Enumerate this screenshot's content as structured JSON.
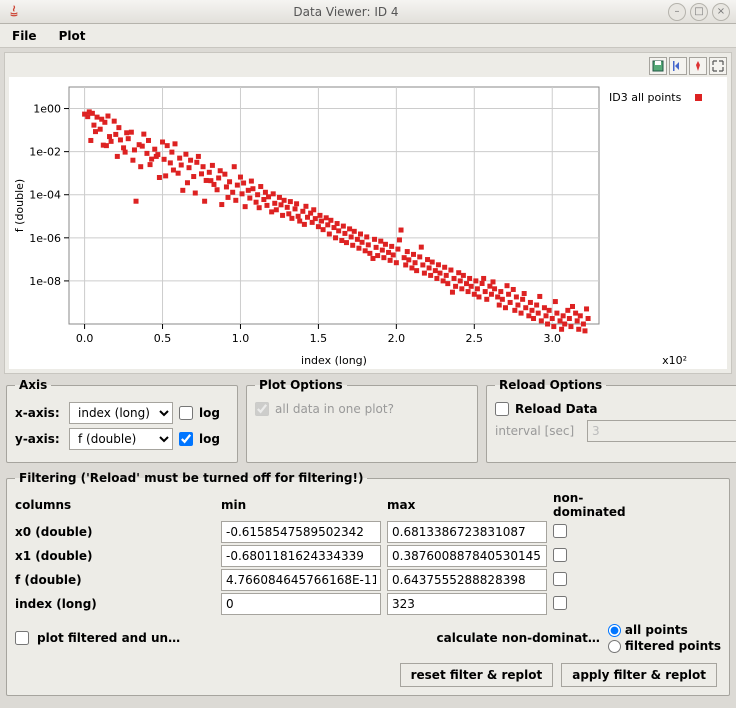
{
  "window": {
    "title": "Data Viewer: ID 4"
  },
  "menubar": {
    "file": "File",
    "plot": "Plot"
  },
  "chart_data": {
    "type": "scatter",
    "xlabel": "index (long)",
    "ylabel": "f (double)",
    "x_ticks": [
      0.0,
      0.5,
      1.0,
      1.5,
      2.0,
      2.5,
      3.0
    ],
    "x_scale_label": "x10²",
    "y_ticks_log10": [
      -8,
      -6,
      -4,
      -2,
      0
    ],
    "y_tick_labels": [
      "1e-08",
      "1e-06",
      "1e-04",
      "1e-02",
      "1e00"
    ],
    "xlim": [
      -0.1,
      3.3
    ],
    "ylim_log10": [
      -10,
      1
    ],
    "legend": [
      {
        "name": "ID3 all points",
        "color": "#dd2222"
      }
    ],
    "series": [
      {
        "name": "ID3 all points",
        "color": "#dd2222",
        "points": [
          [
            0.0,
            0.55
          ],
          [
            0.02,
            0.42
          ],
          [
            0.03,
            0.7
          ],
          [
            0.04,
            0.033
          ],
          [
            0.05,
            0.6
          ],
          [
            0.06,
            0.17
          ],
          [
            0.07,
            0.085
          ],
          [
            0.08,
            0.4
          ],
          [
            0.1,
            0.11
          ],
          [
            0.11,
            0.32
          ],
          [
            0.12,
            0.02
          ],
          [
            0.13,
            0.23
          ],
          [
            0.14,
            0.019
          ],
          [
            0.15,
            0.45
          ],
          [
            0.16,
            0.05
          ],
          [
            0.17,
            0.03
          ],
          [
            0.19,
            0.26
          ],
          [
            0.2,
            0.063
          ],
          [
            0.21,
            0.006
          ],
          [
            0.22,
            0.13
          ],
          [
            0.23,
            0.035
          ],
          [
            0.25,
            0.015
          ],
          [
            0.26,
            0.0095
          ],
          [
            0.27,
            0.075
          ],
          [
            0.28,
            0.04
          ],
          [
            0.3,
            0.08
          ],
          [
            0.31,
            0.004
          ],
          [
            0.32,
            0.012
          ],
          [
            0.33,
            5e-05
          ],
          [
            0.35,
            0.021
          ],
          [
            0.36,
            0.002
          ],
          [
            0.37,
            0.018
          ],
          [
            0.38,
            0.065
          ],
          [
            0.4,
            0.0083
          ],
          [
            0.41,
            0.033
          ],
          [
            0.42,
            0.0025
          ],
          [
            0.43,
            0.0045
          ],
          [
            0.45,
            0.013
          ],
          [
            0.46,
            0.006
          ],
          [
            0.47,
            0.0073
          ],
          [
            0.48,
            0.00063
          ],
          [
            0.5,
            0.028
          ],
          [
            0.51,
            0.0044
          ],
          [
            0.52,
            0.00075
          ],
          [
            0.53,
            0.019
          ],
          [
            0.55,
            0.003
          ],
          [
            0.56,
            0.0095
          ],
          [
            0.57,
            0.0014
          ],
          [
            0.58,
            0.023
          ],
          [
            0.6,
            0.001
          ],
          [
            0.61,
            0.005
          ],
          [
            0.62,
            0.0024
          ],
          [
            0.63,
            0.00016
          ],
          [
            0.65,
            0.0076
          ],
          [
            0.66,
            0.00036
          ],
          [
            0.67,
            0.0018
          ],
          [
            0.68,
            0.004
          ],
          [
            0.7,
            0.0007
          ],
          [
            0.71,
            0.00012
          ],
          [
            0.72,
            0.0032
          ],
          [
            0.73,
            0.006
          ],
          [
            0.75,
            0.00093
          ],
          [
            0.76,
            0.002
          ],
          [
            0.77,
            5e-05
          ],
          [
            0.78,
            0.00046
          ],
          [
            0.8,
            0.0011
          ],
          [
            0.81,
            0.00045
          ],
          [
            0.82,
            0.0023
          ],
          [
            0.83,
            0.0003
          ],
          [
            0.85,
            0.00017
          ],
          [
            0.86,
            0.0006
          ],
          [
            0.87,
            0.0013
          ],
          [
            0.88,
            3.5e-05
          ],
          [
            0.9,
            0.0009
          ],
          [
            0.91,
            0.00023
          ],
          [
            0.92,
            7.5e-05
          ],
          [
            0.93,
            0.0004
          ],
          [
            0.95,
            0.00013
          ],
          [
            0.96,
            0.002
          ],
          [
            0.97,
            5.5e-05
          ],
          [
            0.98,
            0.00028
          ],
          [
            1.0,
            0.00066
          ],
          [
            1.01,
            0.00011
          ],
          [
            1.02,
            0.00035
          ],
          [
            1.03,
            2.8e-05
          ],
          [
            1.05,
            0.00016
          ],
          [
            1.06,
            7e-05
          ],
          [
            1.07,
            0.00043
          ],
          [
            1.08,
            0.00019
          ],
          [
            1.1,
            4.5e-05
          ],
          [
            1.11,
            0.0001
          ],
          [
            1.12,
            2.5e-05
          ],
          [
            1.13,
            0.00024
          ],
          [
            1.15,
            6e-05
          ],
          [
            1.16,
            0.00013
          ],
          [
            1.17,
            3.2e-05
          ],
          [
            1.18,
            8e-05
          ],
          [
            1.2,
            1.6e-05
          ],
          [
            1.21,
            0.00011
          ],
          [
            1.22,
            4e-05
          ],
          [
            1.23,
            2e-05
          ],
          [
            1.25,
            7.5e-05
          ],
          [
            1.26,
            3.4e-05
          ],
          [
            1.27,
            1.1e-05
          ],
          [
            1.28,
            5.5e-05
          ],
          [
            1.3,
            2.6e-05
          ],
          [
            1.31,
            1.3e-05
          ],
          [
            1.32,
            4.8e-05
          ],
          [
            1.33,
            8e-06
          ],
          [
            1.35,
            2.2e-05
          ],
          [
            1.36,
            3.8e-05
          ],
          [
            1.37,
            1e-05
          ],
          [
            1.38,
            6e-06
          ],
          [
            1.4,
            1.7e-05
          ],
          [
            1.41,
            4.2e-06
          ],
          [
            1.42,
            2.9e-05
          ],
          [
            1.43,
            9e-06
          ],
          [
            1.45,
            1.4e-05
          ],
          [
            1.46,
            5.2e-06
          ],
          [
            1.47,
            2e-05
          ],
          [
            1.48,
            7.8e-06
          ],
          [
            1.5,
            3.3e-06
          ],
          [
            1.51,
            1.1e-05
          ],
          [
            1.52,
            6e-06
          ],
          [
            1.53,
            2.4e-06
          ],
          [
            1.55,
            8.5e-06
          ],
          [
            1.56,
            4e-06
          ],
          [
            1.57,
            1.5e-06
          ],
          [
            1.58,
            6.5e-06
          ],
          [
            1.6,
            3e-06
          ],
          [
            1.61,
            1e-06
          ],
          [
            1.62,
            4.6e-06
          ],
          [
            1.63,
            2.1e-06
          ],
          [
            1.65,
            7.5e-07
          ],
          [
            1.66,
            3.5e-06
          ],
          [
            1.67,
            1.6e-06
          ],
          [
            1.68,
            6e-07
          ],
          [
            1.7,
            2.6e-06
          ],
          [
            1.71,
            1.1e-06
          ],
          [
            1.72,
            4.5e-07
          ],
          [
            1.73,
            2e-06
          ],
          [
            1.75,
            8.5e-07
          ],
          [
            1.76,
            3.3e-07
          ],
          [
            1.77,
            1.5e-06
          ],
          [
            1.78,
            6.2e-07
          ],
          [
            1.8,
            2.5e-07
          ],
          [
            1.81,
            1.1e-06
          ],
          [
            1.82,
            4.7e-07
          ],
          [
            1.83,
            1.9e-07
          ],
          [
            1.85,
            1.1e-07
          ],
          [
            1.86,
            8.5e-07
          ],
          [
            1.87,
            3.6e-07
          ],
          [
            1.88,
            1.5e-07
          ],
          [
            1.9,
            7e-07
          ],
          [
            1.91,
            2.7e-07
          ],
          [
            1.92,
            1.2e-07
          ],
          [
            1.93,
            5e-07
          ],
          [
            1.95,
            2.1e-07
          ],
          [
            1.96,
            9e-08
          ],
          [
            1.97,
            4e-07
          ],
          [
            1.98,
            1.6e-07
          ],
          [
            2.0,
            7e-08
          ],
          [
            2.01,
            3e-07
          ],
          [
            2.02,
            8e-07
          ],
          [
            2.03,
            2.3e-06
          ],
          [
            2.05,
            1.2e-07
          ],
          [
            2.06,
            5.5e-08
          ],
          [
            2.07,
            2.3e-07
          ],
          [
            2.08,
            9.5e-08
          ],
          [
            2.1,
            4e-08
          ],
          [
            2.11,
            1.7e-07
          ],
          [
            2.12,
            7e-08
          ],
          [
            2.13,
            3e-08
          ],
          [
            2.15,
            1.3e-07
          ],
          [
            2.16,
            3.7e-07
          ],
          [
            2.17,
            5.5e-08
          ],
          [
            2.18,
            2.3e-08
          ],
          [
            2.2,
            9.8e-08
          ],
          [
            2.21,
            4e-08
          ],
          [
            2.22,
            1.8e-08
          ],
          [
            2.23,
            7.5e-08
          ],
          [
            2.25,
            3e-08
          ],
          [
            2.26,
            1.3e-08
          ],
          [
            2.27,
            5.6e-08
          ],
          [
            2.28,
            2.3e-08
          ],
          [
            2.3,
            1e-08
          ],
          [
            2.31,
            4.3e-08
          ],
          [
            2.32,
            1.8e-08
          ],
          [
            2.33,
            7.5e-09
          ],
          [
            2.35,
            3.2e-08
          ],
          [
            2.36,
            3e-09
          ],
          [
            2.37,
            1.3e-08
          ],
          [
            2.38,
            5.6e-09
          ],
          [
            2.4,
            2.4e-08
          ],
          [
            2.41,
            1e-08
          ],
          [
            2.42,
            4.3e-09
          ],
          [
            2.43,
            1.8e-08
          ],
          [
            2.45,
            7.5e-09
          ],
          [
            2.46,
            3.2e-09
          ],
          [
            2.47,
            1.3e-08
          ],
          [
            2.48,
            5.6e-09
          ],
          [
            2.5,
            2.4e-09
          ],
          [
            2.51,
            1e-08
          ],
          [
            2.52,
            4.3e-09
          ],
          [
            2.53,
            1.8e-09
          ],
          [
            2.55,
            7.6e-09
          ],
          [
            2.56,
            1.3e-08
          ],
          [
            2.57,
            3.2e-09
          ],
          [
            2.58,
            1.4e-09
          ],
          [
            2.6,
            5.7e-09
          ],
          [
            2.61,
            2.4e-09
          ],
          [
            2.62,
            9e-09
          ],
          [
            2.63,
            4.3e-09
          ],
          [
            2.65,
            1.8e-09
          ],
          [
            2.66,
            7.6e-10
          ],
          [
            2.67,
            3.2e-09
          ],
          [
            2.68,
            1.4e-09
          ],
          [
            2.7,
            5.7e-10
          ],
          [
            2.71,
            6e-09
          ],
          [
            2.72,
            2.4e-09
          ],
          [
            2.73,
            1e-09
          ],
          [
            2.75,
            4e-09
          ],
          [
            2.76,
            4.3e-10
          ],
          [
            2.77,
            1.8e-09
          ],
          [
            2.78,
            7.6e-10
          ],
          [
            2.8,
            3.2e-10
          ],
          [
            2.81,
            1.4e-09
          ],
          [
            2.82,
            2.6e-09
          ],
          [
            2.83,
            5.7e-10
          ],
          [
            2.85,
            2.4e-10
          ],
          [
            2.86,
            1e-09
          ],
          [
            2.87,
            4.3e-10
          ],
          [
            2.88,
            1.8e-10
          ],
          [
            2.9,
            7.6e-10
          ],
          [
            2.91,
            3.2e-10
          ],
          [
            2.92,
            1.9e-09
          ],
          [
            2.93,
            1.4e-10
          ],
          [
            2.95,
            5.7e-10
          ],
          [
            2.96,
            2.4e-10
          ],
          [
            2.97,
            1e-10
          ],
          [
            2.98,
            4.3e-10
          ],
          [
            3.0,
            1.8e-10
          ],
          [
            3.01,
            7.6e-11
          ],
          [
            3.02,
            1.1e-09
          ],
          [
            3.03,
            3.2e-10
          ],
          [
            3.05,
            1.4e-10
          ],
          [
            3.06,
            5.7e-11
          ],
          [
            3.07,
            2.4e-10
          ],
          [
            3.08,
            1e-10
          ],
          [
            3.1,
            4.3e-10
          ],
          [
            3.11,
            1.8e-10
          ],
          [
            3.12,
            7.6e-11
          ],
          [
            3.13,
            6.5e-10
          ],
          [
            3.15,
            3.2e-10
          ],
          [
            3.16,
            1.4e-10
          ],
          [
            3.17,
            5.7e-11
          ],
          [
            3.18,
            2.4e-10
          ],
          [
            3.2,
            1e-10
          ],
          [
            3.21,
            4.8e-11
          ],
          [
            3.22,
            5e-10
          ],
          [
            3.23,
            1.8e-10
          ]
        ]
      }
    ]
  },
  "axis": {
    "legend": "Axis",
    "x_label": "x-axis:",
    "y_label": "y-axis:",
    "x_select": "index (long)",
    "y_select": "f (double)",
    "log_label": "log",
    "x_log_checked": false,
    "y_log_checked": true
  },
  "plot_options": {
    "legend": "Plot Options",
    "all_in_one_label": "all data in one plot?",
    "all_in_one_checked": true
  },
  "reload": {
    "legend": "Reload Options",
    "reload_label": "Reload Data",
    "reload_checked": false,
    "interval_label": "interval [sec]",
    "interval_value": "3"
  },
  "filtering": {
    "legend": "Filtering ('Reload' must be turned off for filtering!)",
    "col_hdr": "columns",
    "min_hdr": "min",
    "max_hdr": "max",
    "nondom_hdr": "non-dominated",
    "rows": [
      {
        "name": "x0 (double)",
        "min": "-0.6158547589502342",
        "max": "0.6813386723831087",
        "nd": false
      },
      {
        "name": "x1 (double)",
        "min": "-0.6801181624334339",
        "max": "0.387600887840530145",
        "nd": false
      },
      {
        "name": "f (double)",
        "min": "4.766084645766168E-11",
        "max": "0.6437555288828398",
        "nd": false
      },
      {
        "name": "index (long)",
        "min": "0",
        "max": "323",
        "nd": false
      }
    ],
    "plot_filtered_label": "plot filtered and un…",
    "plot_filtered_checked": false,
    "calc_nondom_label": "calculate non-dominat…",
    "radio_all_label": "all points",
    "radio_filtered_label": "filtered points"
  },
  "buttons": {
    "reset": "reset filter & replot",
    "apply": "apply filter & replot"
  }
}
